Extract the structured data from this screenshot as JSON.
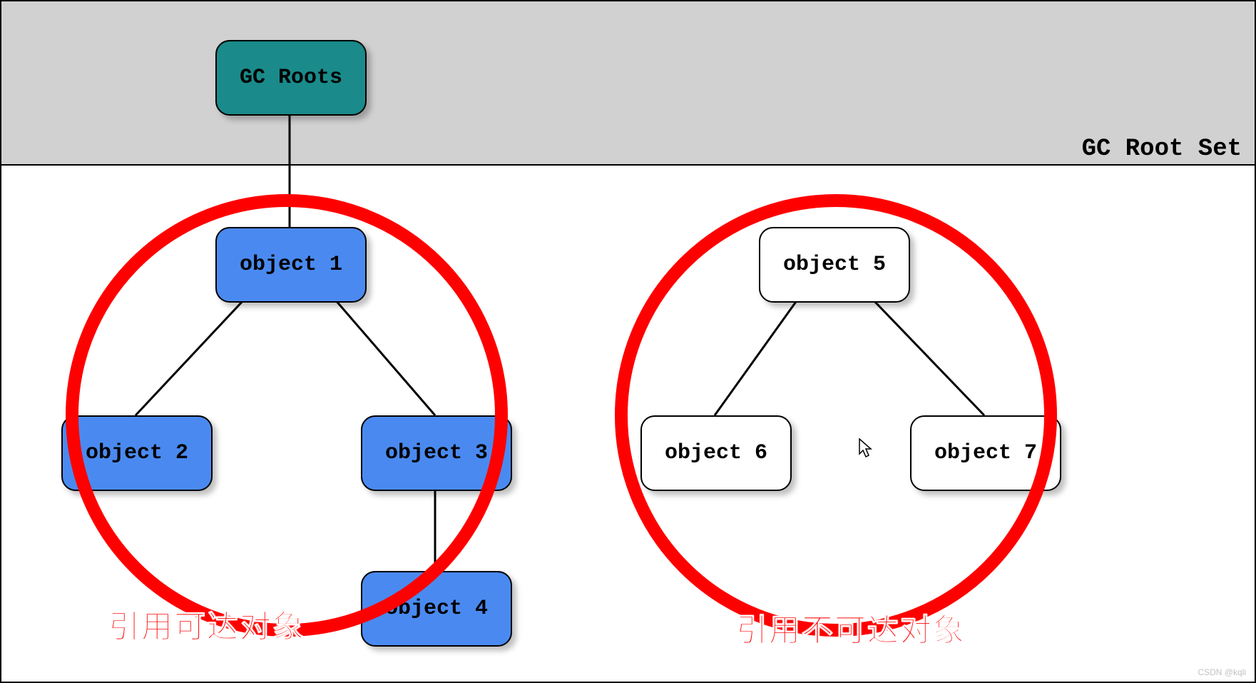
{
  "area_label": "GC Root Set",
  "root": {
    "label": "GC Roots"
  },
  "reachable": {
    "title": "引用可达对象",
    "nodes": {
      "o1": "object 1",
      "o2": "object 2",
      "o3": "object 3",
      "o4": "object 4"
    }
  },
  "unreachable": {
    "title": "引用不可达对象",
    "nodes": {
      "o5": "object 5",
      "o6": "object 6",
      "o7": "object 7"
    }
  },
  "watermark": "CSDN @kqli"
}
